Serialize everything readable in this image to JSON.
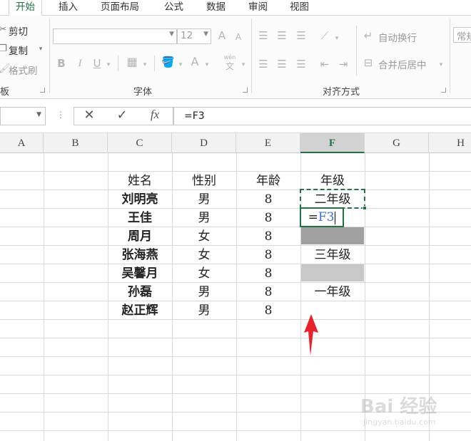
{
  "ribbon_tabs": [
    "开始",
    "插入",
    "页面布局",
    "公式",
    "数据",
    "审阅",
    "视图"
  ],
  "clipboard": {
    "cut": "剪切",
    "copy": "复制",
    "format_painter": "格式刷",
    "group_label": "板"
  },
  "font": {
    "font_size": "12",
    "bold": "B",
    "italic": "I",
    "underline": "U",
    "font_color": "A",
    "grow": "A",
    "shrink": "A",
    "phonetic_top": "wén",
    "phonetic_bottom": "文",
    "group_label": "字体"
  },
  "alignment": {
    "wrap_text": "自动换行",
    "merge_center": "合并后居中",
    "group_label": "对齐方式"
  },
  "number": {
    "format_value": "常规"
  },
  "formula_bar": {
    "fx": "fx",
    "content": "=F3"
  },
  "columns": [
    "A",
    "B",
    "C",
    "D",
    "E",
    "F",
    "G",
    "H"
  ],
  "selected_column": "F",
  "table": {
    "headers": [
      "姓名",
      "性别",
      "年龄",
      "年级"
    ],
    "rows": [
      {
        "name": "刘明亮",
        "gender": "男",
        "age": "8",
        "grade": "二年级"
      },
      {
        "name": "王佳",
        "gender": "男",
        "age": "8",
        "grade": ""
      },
      {
        "name": "周月",
        "gender": "女",
        "age": "8",
        "grade": ""
      },
      {
        "name": "张海燕",
        "gender": "女",
        "age": "8",
        "grade": "三年级"
      },
      {
        "name": "吴馨月",
        "gender": "女",
        "age": "8",
        "grade": ""
      },
      {
        "name": "孙磊",
        "gender": "男",
        "age": "8",
        "grade": "一年级"
      },
      {
        "name": "赵正辉",
        "gender": "男",
        "age": "8",
        "grade": ""
      }
    ]
  },
  "active_cell": {
    "prefix": "=",
    "ref": "F3"
  },
  "colors": {
    "accent": "#217346",
    "ref_blue": "#3b6fd6",
    "fill_dark": "#a0a0a0",
    "fill_light": "#c8c8c8",
    "arrow_red": "#e8212a"
  },
  "watermark": {
    "brand": "Bai 经验",
    "url": "jingyan.baidu.com"
  }
}
